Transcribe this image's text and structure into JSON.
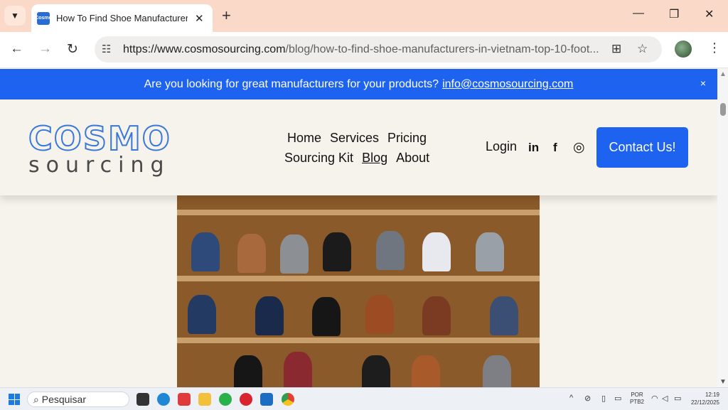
{
  "browser": {
    "tab_title": "How To Find Shoe Manufacturers i",
    "favicon_text": "Cosmo",
    "url_host": "https://www.cosmosourcing.com",
    "url_path": "/blog/how-to-find-shoe-manufacturers-in-vietnam-top-10-foot..."
  },
  "site": {
    "announcement_text": "Are you looking for great manufacturers for your products?",
    "announcement_email": "info@cosmosourcing.com",
    "announcement_close": "×",
    "logo_top": "COSMO",
    "logo_bottom": "sourcing",
    "nav": [
      "Home",
      "Services",
      "Pricing",
      "Sourcing Kit",
      "Blog",
      "About"
    ],
    "login": "Login",
    "social": [
      "in",
      "f",
      "◎"
    ],
    "contact_label": "Contact Us!",
    "brand_color": "#1e63f0"
  },
  "taskbar": {
    "search_placeholder": "Pesquisar",
    "lang_line1": "POR",
    "lang_line2": "PTB2",
    "time": "12:19",
    "date": "22/12/2025"
  }
}
